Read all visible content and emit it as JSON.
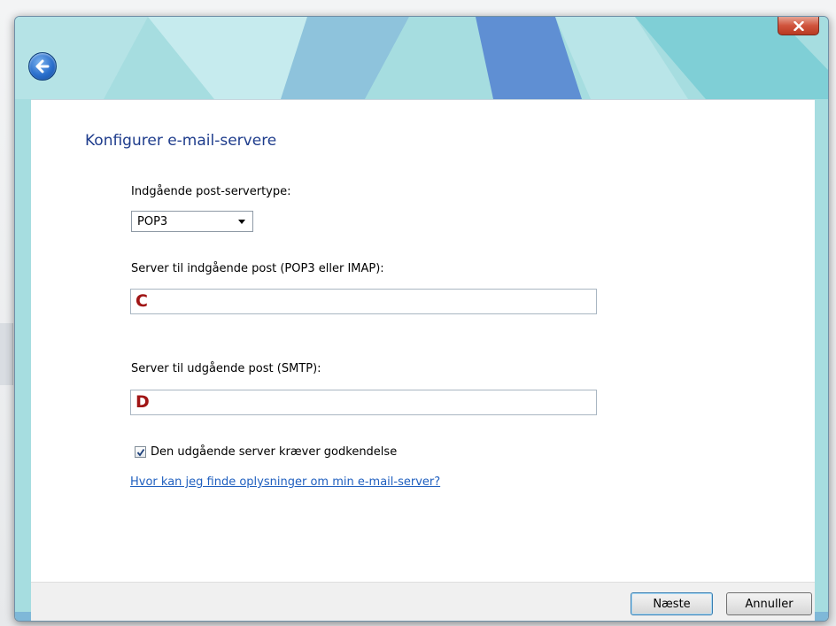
{
  "window": {
    "close_icon": "close-icon",
    "back_icon": "back-arrow-icon"
  },
  "page": {
    "title": "Konfigurer e-mail-servere"
  },
  "incoming_type": {
    "label": "Indgående post-servertype:",
    "selected": "POP3",
    "icon": "chevron-down-icon"
  },
  "incoming_server": {
    "label": "Server til indgående post (POP3 eller IMAP):",
    "value": "C"
  },
  "outgoing_server": {
    "label": "Server til udgående post (SMTP):",
    "value": "D"
  },
  "auth_checkbox": {
    "label": "Den udgående server kræver godkendelse",
    "checked": true
  },
  "help_link": {
    "text": "Hvor kan jeg finde oplysninger om min e-mail-server?"
  },
  "footer": {
    "next_label": "Næste",
    "cancel_label": "Annuller"
  },
  "colors": {
    "title": "#1e3c8c",
    "link": "#1f5fbf",
    "input_text": "#a01515",
    "frame": "#9fdcdf"
  }
}
